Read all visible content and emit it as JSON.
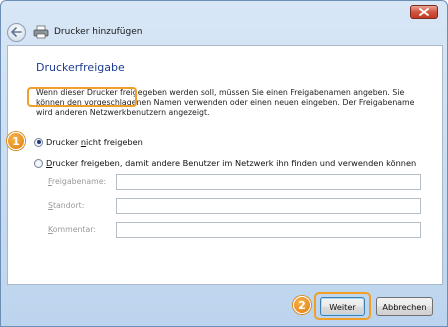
{
  "window": {
    "title": "Drucker hinzufügen"
  },
  "page": {
    "heading": "Druckerfreigabe",
    "description": "Wenn dieser Drucker freigegeben werden soll, müssen Sie einen Freigabenamen angeben. Sie können den vorgeschlagenen Namen verwenden oder einen neuen eingeben. Der Freigabename wird anderen Netzwerkbenutzern angezeigt."
  },
  "options": {
    "no_share": {
      "mnemonic_pre": "Drucker ",
      "mnemonic": "n",
      "label_post": "icht freigeben",
      "selected": true
    },
    "share": {
      "mnemonic": "D",
      "label_post": "rucker freigeben, damit andere Benutzer im Netzwerk ihn finden und verwenden können",
      "selected": false
    }
  },
  "fields": [
    {
      "mnemonic": "F",
      "rest": "reigabename:",
      "value": ""
    },
    {
      "mnemonic": "S",
      "rest": "tandort:",
      "value": ""
    },
    {
      "mnemonic": "K",
      "rest": "ommentar:",
      "value": ""
    }
  ],
  "badges": {
    "one": "1",
    "two": "2"
  },
  "buttons": {
    "next": "Weiter",
    "cancel": "Abbrechen"
  },
  "colors": {
    "highlight": "#f0a026",
    "heading": "#1e3d8f"
  },
  "icons": {
    "back": "back-arrow-icon",
    "printer": "printer-icon",
    "close": "close-icon"
  }
}
